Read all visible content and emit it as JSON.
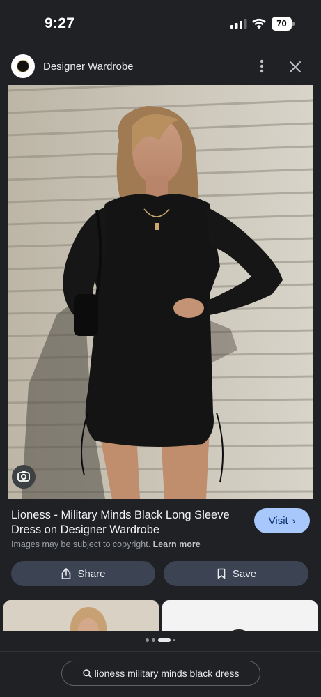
{
  "status_bar": {
    "time": "9:27",
    "battery": "70"
  },
  "header": {
    "site_name": "Designer Wardrobe"
  },
  "result": {
    "title": "Lioness - Military Minds Black Long Sleeve Dress on Designer Wardrobe",
    "visit_label": "Visit",
    "copyright_text": "Images may be subject to copyright.",
    "learn_more_label": "Learn more"
  },
  "actions": {
    "share_label": "Share",
    "save_label": "Save"
  },
  "search": {
    "query": "lioness military minds black dress"
  },
  "pagination": {
    "total_dots": 4,
    "active_index": 2
  },
  "icons": {
    "signal": "cellular-signal-icon",
    "wifi": "wifi-icon",
    "more": "more-vertical-icon",
    "close": "close-icon",
    "lens": "google-lens-icon",
    "share": "share-icon",
    "save": "bookmark-icon",
    "search": "search-icon"
  },
  "colors": {
    "background": "#1f2125",
    "visit_button": "#a8c7fa",
    "action_button": "#3c4453"
  }
}
